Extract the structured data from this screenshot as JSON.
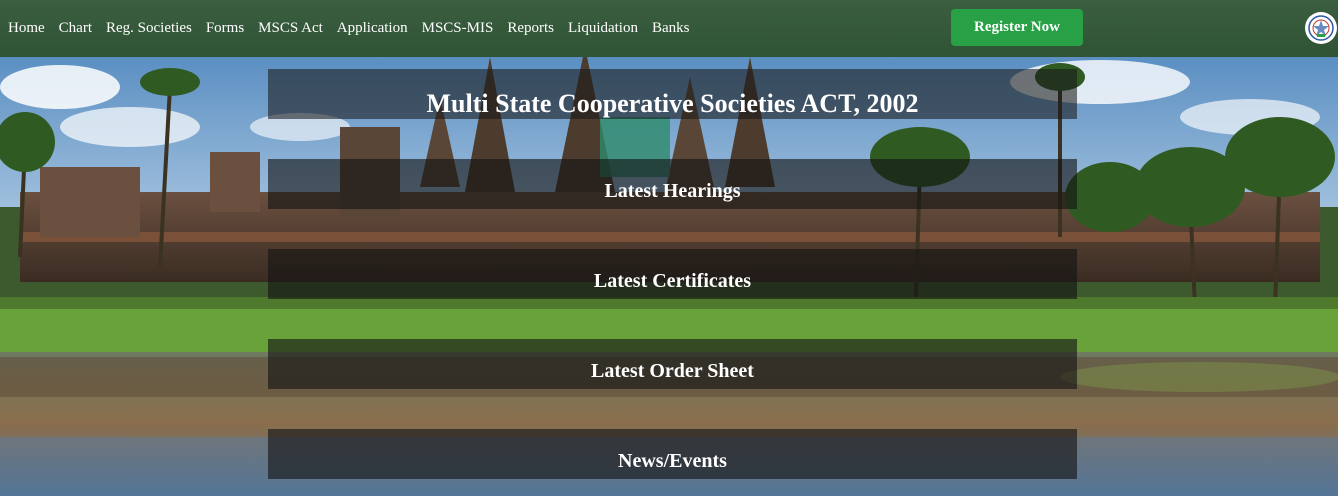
{
  "nav": {
    "items": [
      {
        "label": "Home",
        "name": "nav-home"
      },
      {
        "label": "Chart",
        "name": "nav-chart"
      },
      {
        "label": "Reg. Societies",
        "name": "nav-reg-societies"
      },
      {
        "label": "Forms",
        "name": "nav-forms"
      },
      {
        "label": "MSCS Act",
        "name": "nav-mscs-act"
      },
      {
        "label": "Application",
        "name": "nav-application"
      },
      {
        "label": "MSCS-MIS",
        "name": "nav-mscs-mis"
      },
      {
        "label": "Reports",
        "name": "nav-reports"
      },
      {
        "label": "Liquidation",
        "name": "nav-liquidation"
      },
      {
        "label": "Banks",
        "name": "nav-banks"
      }
    ],
    "register_label": "Register Now",
    "emblem_icon": "government-emblem-icon"
  },
  "hero": {
    "title": "Multi State Cooperative Societies ACT, 2002",
    "background_icon": "temple-landscape-photo"
  },
  "sections": {
    "hearings": {
      "heading": "Latest Hearings"
    },
    "certificates": {
      "heading": "Latest Certificates"
    },
    "order_sheet": {
      "heading": "Latest Order Sheet"
    },
    "news": {
      "heading": "News/Events"
    }
  },
  "colors": {
    "navbar": "#2f5335",
    "register_button": "#28a046",
    "panel_overlay": "rgba(20,20,20,0.62)"
  }
}
